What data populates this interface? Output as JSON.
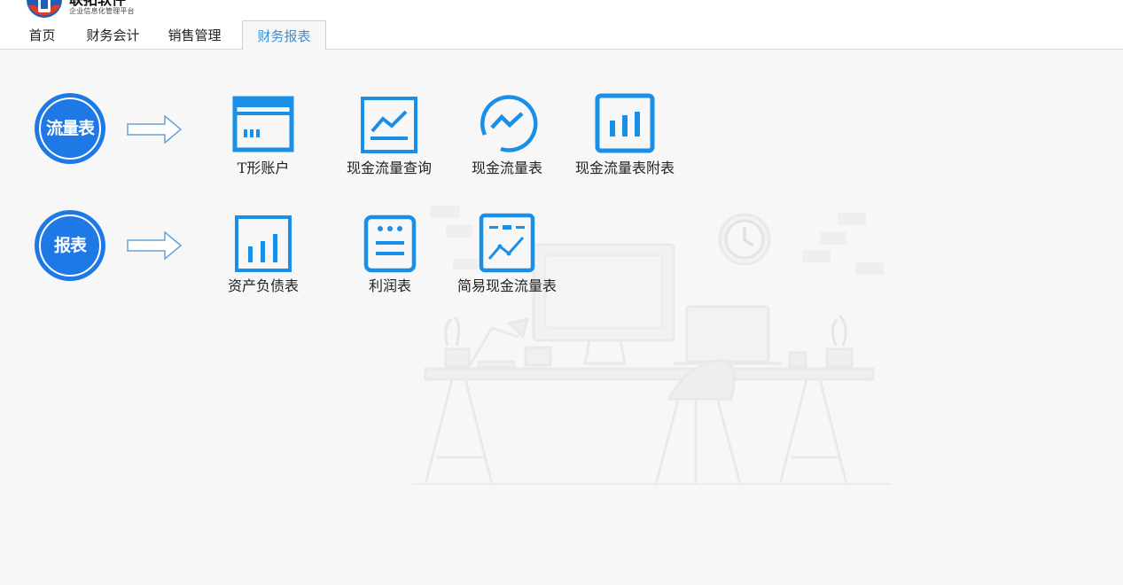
{
  "app": {
    "brand_name": "联拓软件",
    "brand_subtitle": "企业信息化管理平台"
  },
  "tabs": [
    {
      "label": "首页",
      "active": false
    },
    {
      "label": "财务会计",
      "active": false
    },
    {
      "label": "销售管理",
      "active": false
    },
    {
      "label": "财务报表",
      "active": true
    }
  ],
  "rows": [
    {
      "category": "流量表",
      "items": [
        {
          "label": "T形账户",
          "icon": "t-account-icon"
        },
        {
          "label": "现金流量查询",
          "icon": "line-chart-icon"
        },
        {
          "label": "现金流量表",
          "icon": "trend-circle-icon"
        },
        {
          "label": "现金流量表附表",
          "icon": "bar-chart-icon"
        }
      ]
    },
    {
      "category": "报表",
      "items": [
        {
          "label": "资产负债表",
          "icon": "bar-chart-icon"
        },
        {
          "label": "利润表",
          "icon": "list-icon"
        },
        {
          "label": "简易现金流量表",
          "icon": "report-line-icon"
        }
      ]
    }
  ],
  "colors": {
    "accent": "#1e79e6",
    "icon_blue": "#1a8fe8",
    "active_tab_text": "#3b8fd9",
    "background": "#f7f7f7"
  }
}
